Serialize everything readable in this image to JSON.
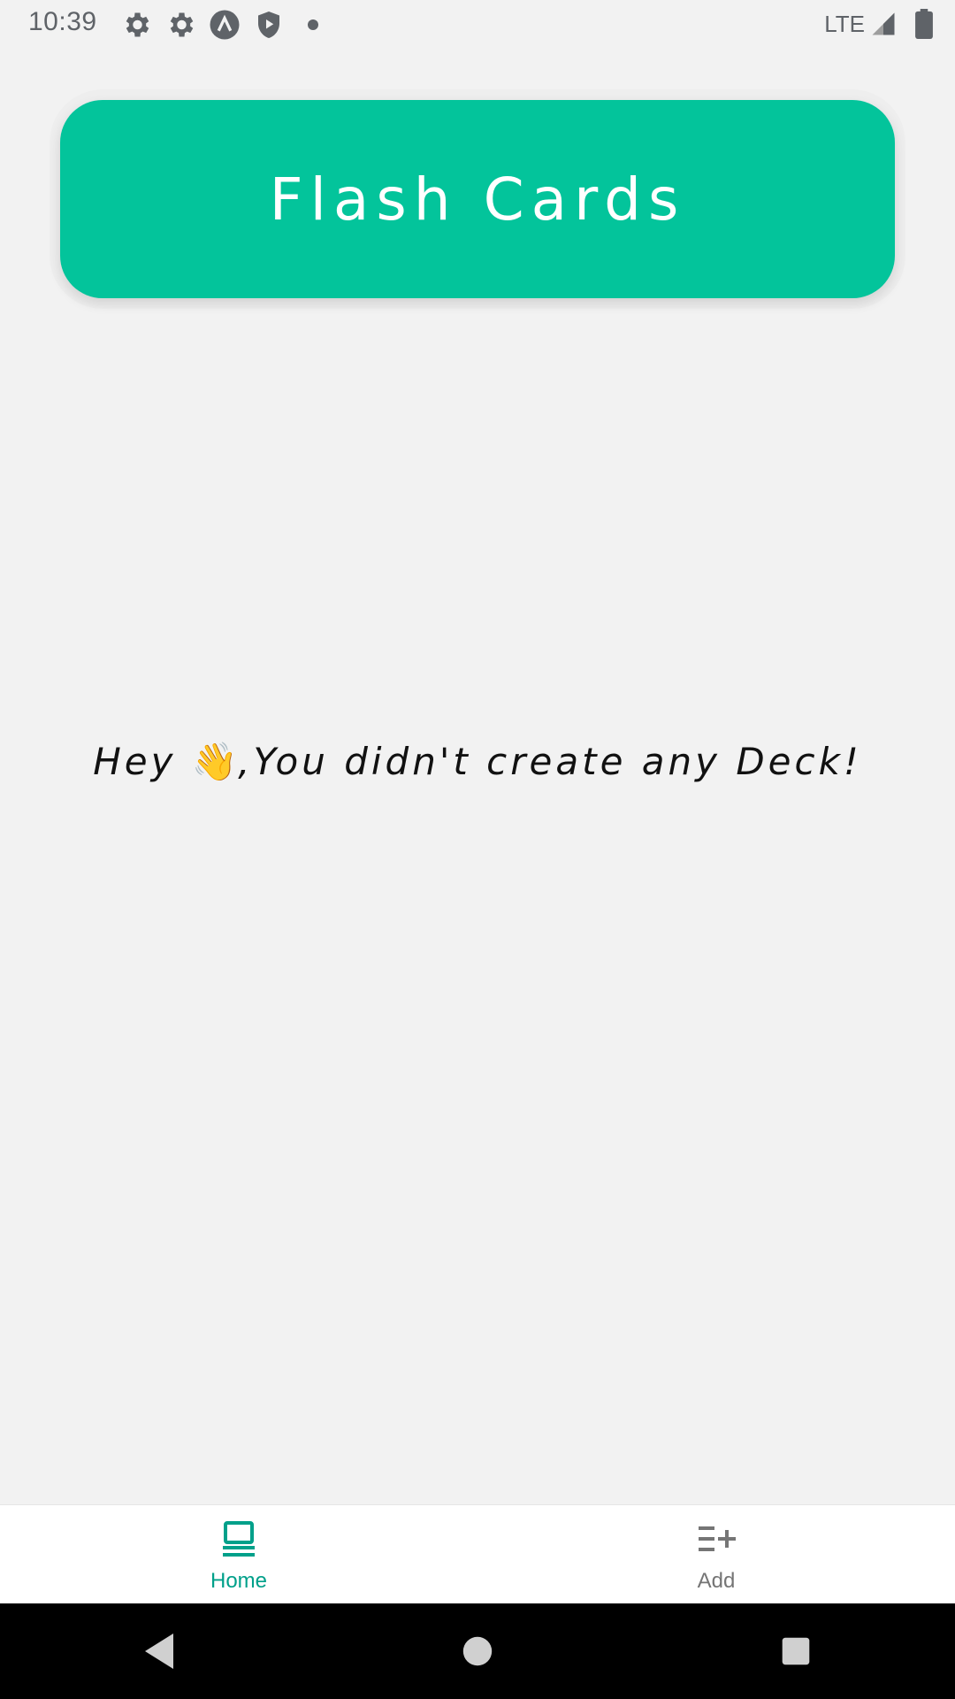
{
  "status_bar": {
    "time": "10:39",
    "network": "LTE",
    "icons": [
      "settings-icon",
      "settings-icon",
      "assistant-icon",
      "shield-play-icon",
      "dot-icon",
      "signal-icon",
      "battery-icon"
    ]
  },
  "header": {
    "title": "Flash Cards",
    "color": "#03c49b"
  },
  "empty_state": {
    "prefix": "Hey ",
    "emoji": "👋",
    "message": ",You didn't create any Deck!"
  },
  "bottom_nav": {
    "items": [
      {
        "label": "Home",
        "icon": "cards-icon",
        "active": true,
        "color": "#00a08a"
      },
      {
        "label": "Add",
        "icon": "playlist-add-icon",
        "active": false,
        "color": "#757575"
      }
    ]
  },
  "system_nav": {
    "buttons": [
      "back-icon",
      "home-icon",
      "recents-icon"
    ]
  }
}
